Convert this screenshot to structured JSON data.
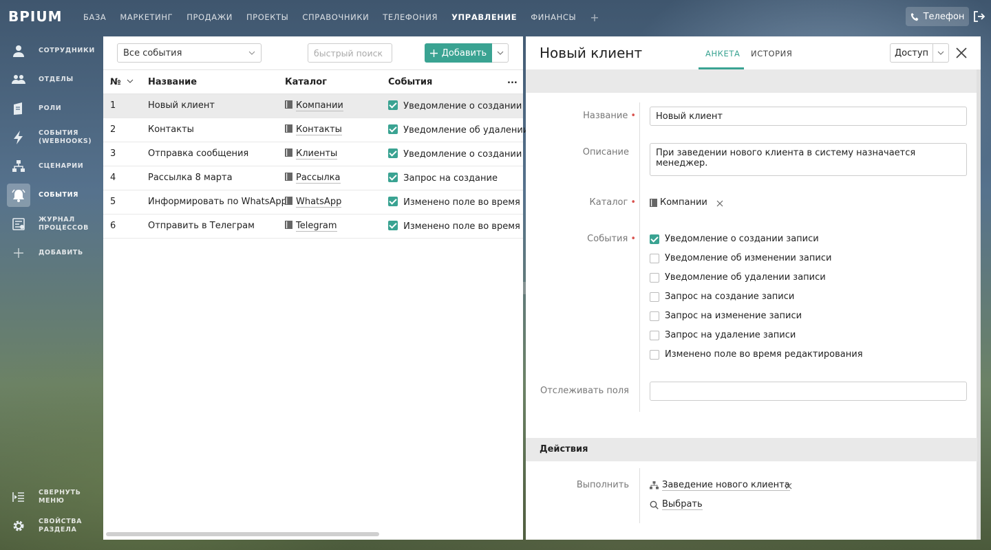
{
  "app": {
    "logo": "BPIUM"
  },
  "topnav": {
    "items": [
      "БАЗА",
      "МАРКЕТИНГ",
      "ПРОДАЖИ",
      "ПРОЕКТЫ",
      "СПРАВОЧНИКИ",
      "ТЕЛЕФОНИЯ",
      "УПРАВЛЕНИЕ",
      "ФИНАНСЫ"
    ],
    "active": "УПРАВЛЕНИЕ",
    "plus": "+",
    "phone_label": "Телефон"
  },
  "sidebar": {
    "items": [
      {
        "label": "СОТРУДНИКИ",
        "icon": "user-icon"
      },
      {
        "label": "ОТДЕЛЫ",
        "icon": "users-icon"
      },
      {
        "label": "РОЛИ",
        "icon": "roles-icon"
      },
      {
        "label": "СОБЫТИЯ\n(WEBHOOKS)",
        "icon": "lightning-icon"
      },
      {
        "label": "СЦЕНАРИИ",
        "icon": "hierarchy-icon"
      },
      {
        "label": "СОБЫТИЯ",
        "icon": "bell-icon",
        "active": true
      },
      {
        "label": "ЖУРНАЛ\nПРОЦЕССОВ",
        "icon": "journal-icon"
      },
      {
        "label": "ДОБАВИТЬ",
        "icon": "plus-icon"
      }
    ],
    "bottom": [
      {
        "label": "СВЕРНУТЬ\nМЕНЮ",
        "icon": "collapse-menu-icon"
      },
      {
        "label": "СВОЙСТВА\nРАЗДЕЛА",
        "icon": "gear-icon"
      }
    ]
  },
  "list": {
    "filter_value": "Все события",
    "search_placeholder": "быстрый поиск",
    "add_label": "Добавить",
    "columns": {
      "num": "№",
      "name": "Название",
      "catalog": "Каталог",
      "events": "События",
      "more": "..."
    },
    "rows": [
      {
        "num": "1",
        "name": "Новый клиент",
        "catalog": "Компании",
        "event": "Уведомление о создании",
        "selected": true
      },
      {
        "num": "2",
        "name": "Контакты",
        "catalog": "Контакты",
        "event": "Уведомление об удалении"
      },
      {
        "num": "3",
        "name": "Отправка сообщения",
        "catalog": "Клиенты",
        "event": "Уведомление о создании"
      },
      {
        "num": "4",
        "name": "Рассылка 8 марта",
        "catalog": "Рассылка",
        "event": "Запрос на создание"
      },
      {
        "num": "5",
        "name": "Информировать по WhatsApp",
        "catalog": "WhatsApp",
        "event": "Изменено поле во время"
      },
      {
        "num": "6",
        "name": "Отправить в Телеграм",
        "catalog": "Telegram",
        "event": "Изменено поле во время"
      }
    ]
  },
  "card": {
    "title": "Новый клиент",
    "tabs": [
      "АНКЕТА",
      "ИСТОРИЯ"
    ],
    "active_tab": "АНКЕТА",
    "access_label": "Доступ",
    "labels": {
      "name": "Название",
      "description": "Описание",
      "catalog": "Каталог",
      "events": "События",
      "track": "Отслеживать поля",
      "execute": "Выполнить"
    },
    "name_value": "Новый клиент",
    "description_value": "При заведении нового клиента в систему назначается менеджер.",
    "catalog_value": "Компании",
    "events": [
      {
        "label": "Уведомление о создании записи",
        "checked": true
      },
      {
        "label": "Уведомление об изменении записи",
        "checked": false
      },
      {
        "label": "Уведомление об удалении записи",
        "checked": false
      },
      {
        "label": "Запрос на создание записи",
        "checked": false
      },
      {
        "label": "Запрос на изменение записи",
        "checked": false
      },
      {
        "label": "Запрос на удаление записи",
        "checked": false
      },
      {
        "label": "Изменено поле во время редактирования",
        "checked": false
      }
    ],
    "track_value": "",
    "actions_title": "Действия",
    "action_value": "Заведение нового клиента",
    "select_label": "Выбрать"
  },
  "colors": {
    "accent": "#3aa392",
    "required": "#d9534f"
  }
}
